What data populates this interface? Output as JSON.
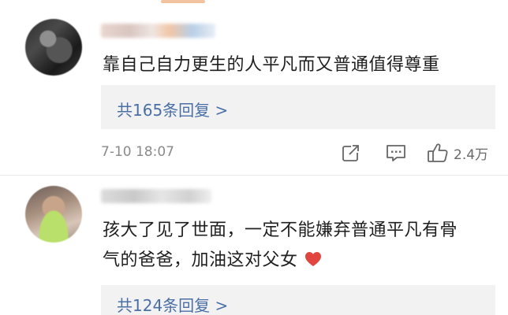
{
  "comments": [
    {
      "text": "靠自己自力更生的人平凡而又普通值得尊重",
      "reply_label": "共165条回复 >",
      "timestamp": "7-10 18:07",
      "like_count": "2.4万"
    },
    {
      "text_line1": "孩大了见了世面，一定不能嫌弃普通平凡有骨",
      "text_line2": "气的爸爸，加油这对父女",
      "reply_label": "共124条回复 >"
    }
  ],
  "icons": {
    "share": "share-icon",
    "comment": "comment-icon",
    "like": "thumbs-up-icon",
    "heart": "red-heart-emoji"
  },
  "colors": {
    "reply_link": "#4a6fa5",
    "heart": "#e0463f",
    "text": "#1f1f1f",
    "meta": "#8a8a8a"
  }
}
